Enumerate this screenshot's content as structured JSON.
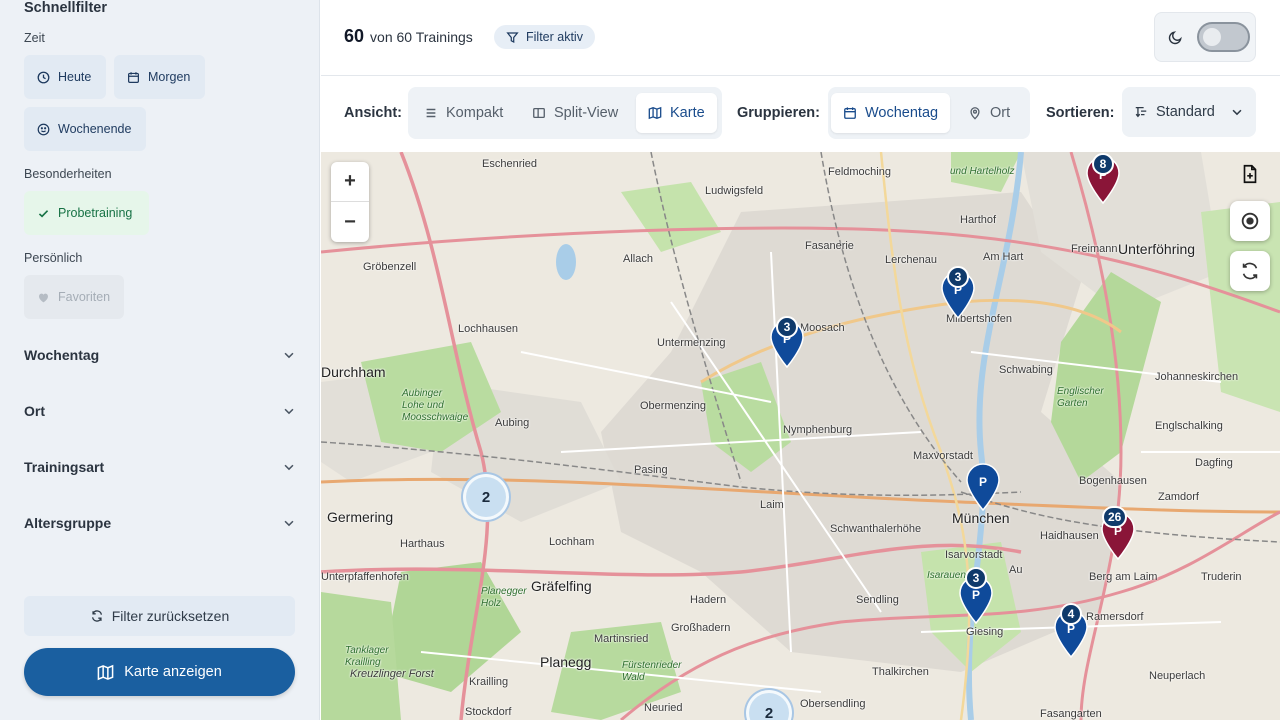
{
  "sidebar": {
    "title": "Schnellfilter",
    "sections": {
      "zeit": "Zeit",
      "besonderheiten": "Besonderheiten",
      "persoenlich": "Persönlich"
    },
    "chips": {
      "heute": "Heute",
      "morgen": "Morgen",
      "wochenende": "Wochenende",
      "probetraining": "Probetraining",
      "favoriten": "Favoriten"
    },
    "accordions": [
      "Wochentag",
      "Ort",
      "Trainingsart",
      "Altersgruppe"
    ],
    "reset_label": "Filter zurücksetzen",
    "map_button_label": "Karte anzeigen"
  },
  "header": {
    "count": "60",
    "count_suffix": "von 60 Trainings",
    "filter_label": "Filter aktiv"
  },
  "toolbar": {
    "ansicht_label": "Ansicht:",
    "views": [
      "Kompakt",
      "Split-View",
      "Karte"
    ],
    "active_view": "Karte",
    "gruppieren_label": "Gruppieren:",
    "groups": [
      "Wochentag",
      "Ort"
    ],
    "active_group": "Wochentag",
    "sortieren_label": "Sortieren:",
    "sort_value": "Standard"
  },
  "map": {
    "zoom_in": "+",
    "zoom_out": "−",
    "places": [
      "Eschenried",
      "Ludwigsfeld",
      "Feldmoching",
      "Gröbenzell",
      "Allach",
      "Fasanerie",
      "Lerchenau",
      "Harthof",
      "Am Hart",
      "Freimann",
      "Unterföhring",
      "Lochhausen",
      "Untermenzing",
      "Milbertshofen",
      "Schwabing",
      "Johanneskirchen",
      "Aubing",
      "Obermenzing",
      "Nymphenburg",
      "Englschalking",
      "Pasing",
      "Maxvorstadt",
      "Bogenhausen",
      "Dagfing",
      "Germering",
      "Harthaus",
      "Laim",
      "Schwanthalerhöhe",
      "München",
      "Haidhausen",
      "Zamdorf",
      "Lochham",
      "Isarvorstadt",
      "Au",
      "Berg am Laim",
      "Truderin",
      "Unterpfaffenhofen",
      "Gräfelfing",
      "Hadern",
      "Sendling",
      "Giesing",
      "Ramersdorf",
      "Martinsried",
      "Großhadern",
      "Planegg",
      "Thalkirchen",
      "Neuperlach",
      "Krailling",
      "Neuried",
      "Obersendling",
      "Fasangarten",
      "Stockdorf",
      "Aubinger Lohe und Moosschwaige",
      "Englischer Garten",
      "Planegger Holz",
      "Tanklager Krailling",
      "Kreuzlinger Forst",
      "Fürstenrieder Wald",
      "und Hartelholz",
      "Isarauen",
      "Moosach",
      "Durchham"
    ],
    "pins": [
      {
        "label": "8",
        "color": "#8a1538"
      },
      {
        "label": "3",
        "color": "#0f4a9a"
      },
      {
        "label": "3",
        "color": "#0f4a9a"
      },
      {
        "label": "",
        "color": "#0f4a9a"
      },
      {
        "label": "26",
        "color": "#8a1538"
      },
      {
        "label": "3",
        "color": "#0f4a9a"
      },
      {
        "label": "4",
        "color": "#0f4a9a"
      }
    ],
    "clusters": [
      "2",
      "2"
    ],
    "marker_letter": "P"
  },
  "colors": {
    "primary": "#1a5fa0",
    "pin_blue": "#0f4a9a",
    "pin_maroon": "#8a1538",
    "active_text": "#1a4c8c"
  }
}
